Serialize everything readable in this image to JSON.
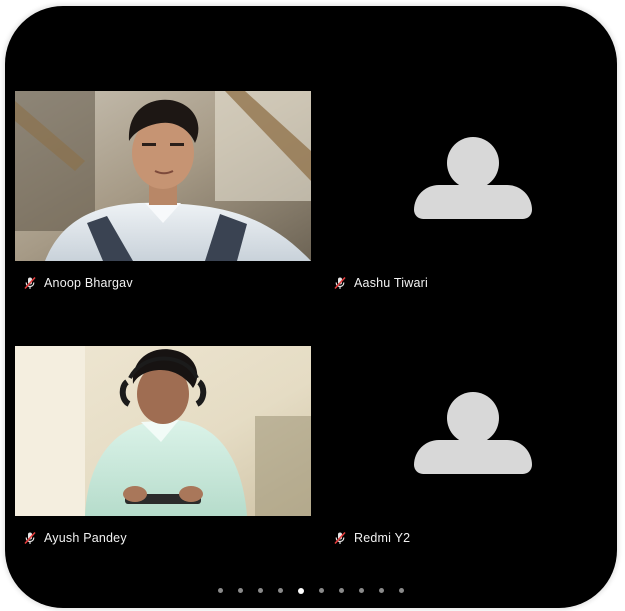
{
  "participants": [
    {
      "name": "Anoop Bhargav",
      "has_video": true,
      "mic_state": "muted"
    },
    {
      "name": "Aashu Tiwari",
      "has_video": false,
      "mic_state": "muted"
    },
    {
      "name": "Ayush Pandey",
      "has_video": true,
      "mic_state": "muted"
    },
    {
      "name": "Redmi Y2",
      "has_video": false,
      "mic_state": "muted"
    }
  ],
  "icons": {
    "mic": "mic-muted-icon",
    "avatar": "person-placeholder-icon"
  },
  "pagination": {
    "dot_count": 10,
    "active_index": 4
  },
  "colors": {
    "background": "#000000",
    "avatar": "#d8d8d8",
    "name_text": "#f2f2f2",
    "active_dot": "#ffffff",
    "inactive_dot": "#8a8a8a"
  }
}
